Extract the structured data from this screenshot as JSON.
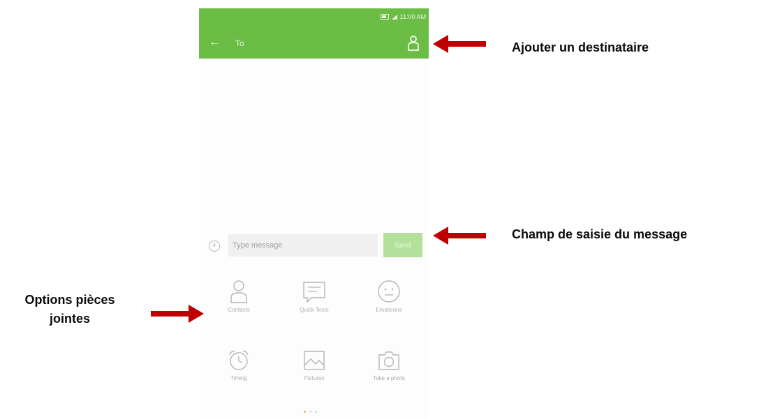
{
  "status_bar": {
    "time": "11:00 AM"
  },
  "header": {
    "back_icon": "arrow-left-icon",
    "to_placeholder": "To",
    "contact_icon": "person-add-icon"
  },
  "composer": {
    "plus_icon": "plus-circle-icon",
    "placeholder": "Type message",
    "send_label": "Send"
  },
  "attachment_options": [
    {
      "label": "Contacts",
      "icon": "contact-icon"
    },
    {
      "label": "Quick Texts",
      "icon": "quick-text-icon"
    },
    {
      "label": "Emoticons",
      "icon": "emoticon-icon"
    },
    {
      "label": "Timing",
      "icon": "alarm-clock-icon"
    },
    {
      "label": "Pictures",
      "icon": "image-icon"
    },
    {
      "label": "Take a photo",
      "icon": "camera-icon"
    }
  ],
  "pager": {
    "pages": 3,
    "current": 1
  },
  "annotations": {
    "add_recipient": "Ajouter un destinataire",
    "message_field": "Champ de saisie du message",
    "attachments_line1": "Options pièces",
    "attachments_line2": "jointes"
  },
  "colors": {
    "header_green": "#6cbd45",
    "send_green": "#b3e19c",
    "arrow_red": "#c00000",
    "dot_active": "#e8b955"
  }
}
